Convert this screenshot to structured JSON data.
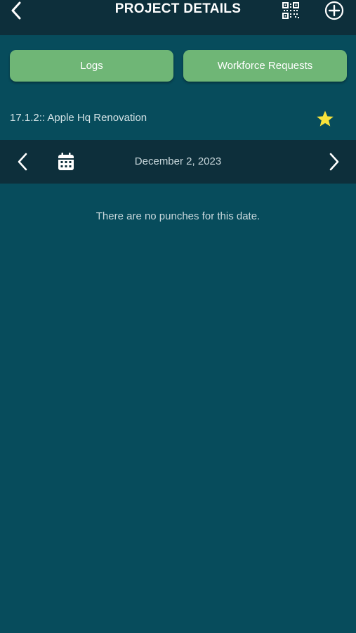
{
  "header": {
    "title": "PROJECT DETAILS",
    "icons": {
      "back": "chevron-left-icon",
      "qr": "qr-code-icon",
      "add": "plus-circle-icon"
    }
  },
  "actions": {
    "logs_label": "Logs",
    "workforce_label": "Workforce Requests"
  },
  "project": {
    "name": "17.1.2:: Apple Hq Renovation",
    "favorite_icon": "star-icon",
    "favorite_color": "#f7e23b"
  },
  "date_nav": {
    "date": "December 2, 2023",
    "icons": {
      "prev": "chevron-left-icon",
      "calendar": "calendar-icon",
      "next": "chevron-right-icon"
    }
  },
  "content": {
    "empty_message": "There are no punches for this date."
  },
  "colors": {
    "background": "#074c5c",
    "bar": "#0d2f3b",
    "button": "#6fb676"
  }
}
